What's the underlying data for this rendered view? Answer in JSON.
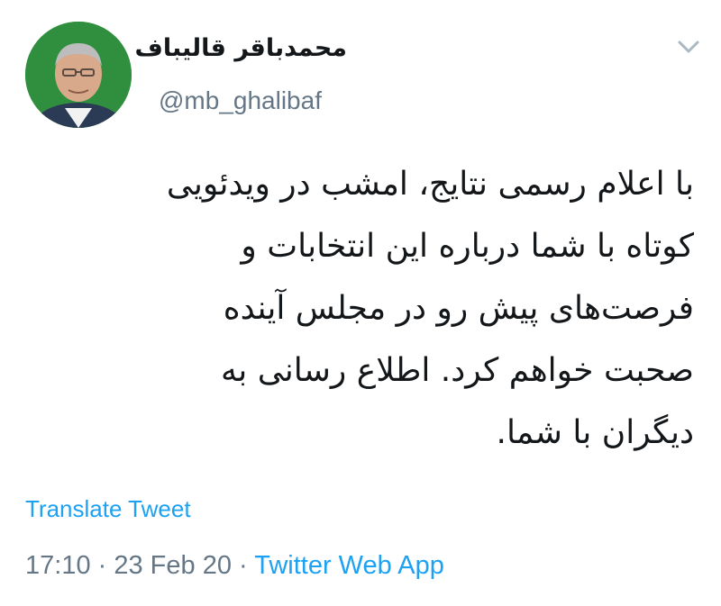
{
  "author": {
    "display_name": "محمدباقر قالیباف",
    "handle": "@mb_ghalibaf",
    "avatar_icon": "profile-photo"
  },
  "menu": {
    "icon": "chevron-down-icon"
  },
  "tweet": {
    "lines": [
      "با اعلام رسمی نتایج، امشب در ویدئویی",
      "کوتاه با شما درباره این انتخابات و",
      "فرصت‌های پیش رو در مجلس آینده",
      "صحبت خواهم کرد. اطلاع رسانی به",
      "دیگران با شما."
    ]
  },
  "translate_label": "Translate Tweet",
  "footer": {
    "time": "17:10",
    "separator": " · ",
    "date": "23 Feb 20",
    "separator2": " · ",
    "source": "Twitter Web App"
  },
  "colors": {
    "link": "#1da1f2",
    "muted": "#657786",
    "text": "#14171a",
    "avatar_bg": "#2f8f3e"
  }
}
